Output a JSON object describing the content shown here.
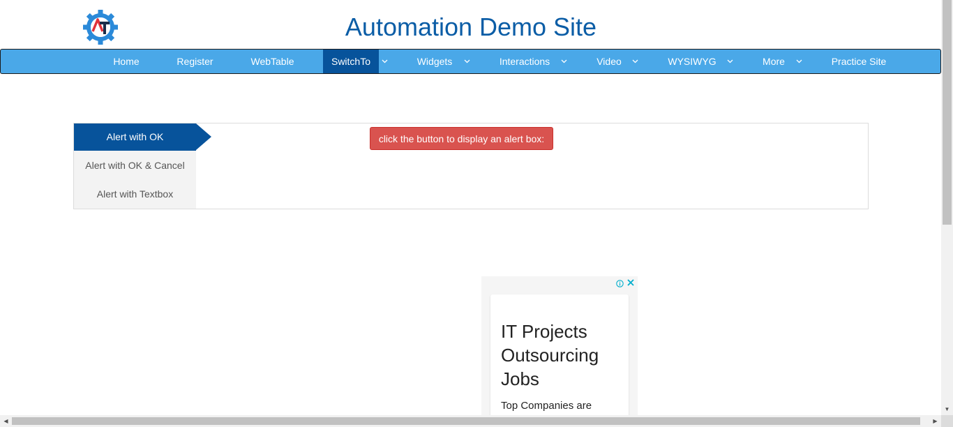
{
  "header": {
    "title": "Automation Demo Site",
    "logo_icon": "at-gear-logo-icon",
    "logo_colors": {
      "gear": "#2b8ad9",
      "a": "#e2323a",
      "t": "#1b2e4a"
    }
  },
  "nav": {
    "items": [
      {
        "label": "Home",
        "has_dropdown": false,
        "active": false
      },
      {
        "label": "Register",
        "has_dropdown": false,
        "active": false
      },
      {
        "label": "WebTable",
        "has_dropdown": false,
        "active": false
      },
      {
        "label": "SwitchTo",
        "has_dropdown": true,
        "active": true
      },
      {
        "label": "Widgets",
        "has_dropdown": true,
        "active": false
      },
      {
        "label": "Interactions",
        "has_dropdown": true,
        "active": false
      },
      {
        "label": "Video",
        "has_dropdown": true,
        "active": false
      },
      {
        "label": "WYSIWYG",
        "has_dropdown": true,
        "active": false
      },
      {
        "label": "More",
        "has_dropdown": true,
        "active": false
      },
      {
        "label": "Practice Site",
        "has_dropdown": false,
        "active": false
      }
    ],
    "bar_color": "#4aa8e8",
    "active_color": "#07539b"
  },
  "alerts": {
    "tabs": [
      {
        "label": "Alert with OK",
        "active": true
      },
      {
        "label": "Alert with OK & Cancel",
        "active": false
      },
      {
        "label": "Alert with Textbox",
        "active": false
      }
    ],
    "button_label": "click the button to display an alert box:",
    "button_color": "#d9534f"
  },
  "ad": {
    "headline": "IT Projects Outsourcing Jobs",
    "body": "Top Companies are",
    "info_icon": "info-icon",
    "close_icon": "close-icon",
    "accent_color": "#00aecd"
  }
}
